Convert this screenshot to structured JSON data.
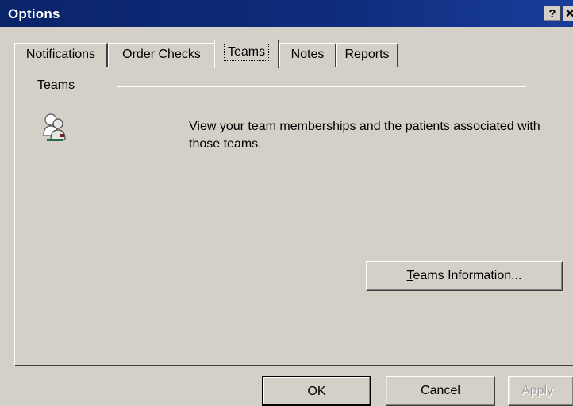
{
  "window": {
    "title": "Options",
    "help_glyph": "?",
    "close_glyph": "✕",
    "accent_color": "#0a246a"
  },
  "tabs": [
    {
      "label": "Notifications",
      "active": false
    },
    {
      "label": "Order Checks",
      "active": false
    },
    {
      "label": "Teams",
      "active": true
    },
    {
      "label": "Notes",
      "active": false
    },
    {
      "label": "Reports",
      "active": false
    }
  ],
  "panel": {
    "section_label": "Teams",
    "icon": "teams-people-icon",
    "description": "View your team memberships and the patients associated with those teams.",
    "teams_info_button": {
      "mnemonic": "T",
      "rest": "eams Information..."
    }
  },
  "buttons": {
    "ok": "OK",
    "cancel": "Cancel",
    "apply": "Apply"
  }
}
